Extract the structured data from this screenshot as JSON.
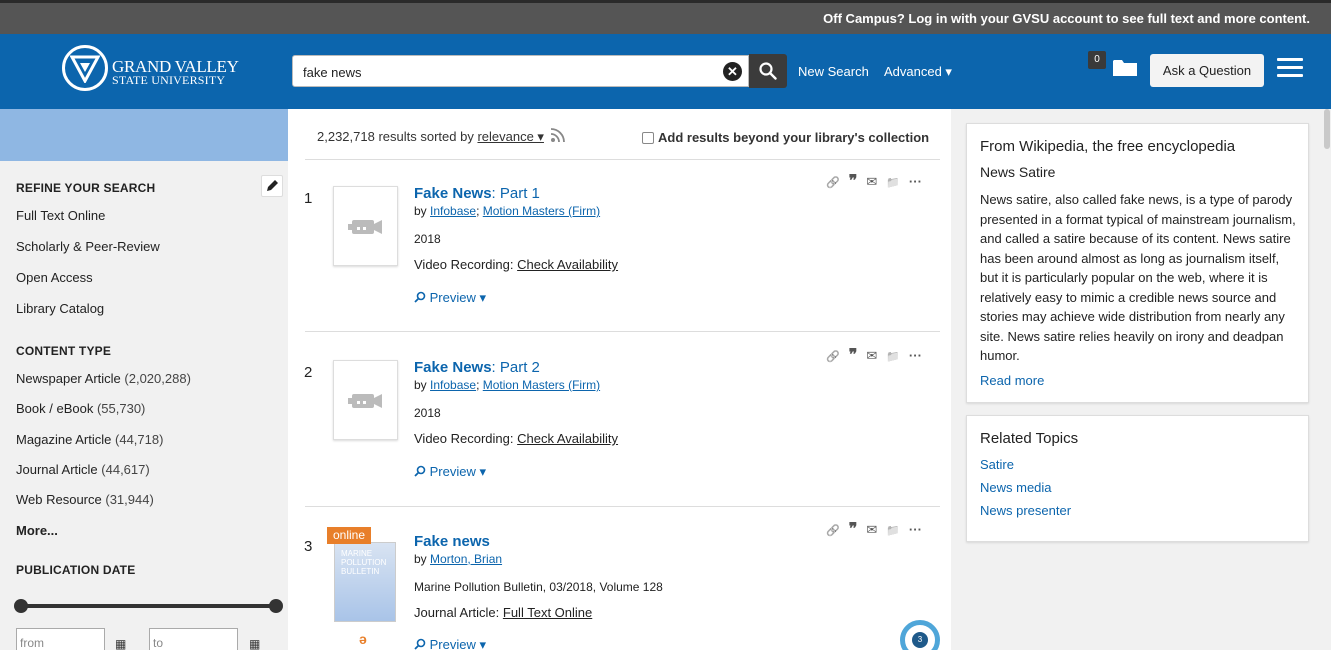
{
  "topbar": {
    "message": "Off Campus? Log in with your GVSU account to see full text and more content."
  },
  "logo": {
    "line1": "GRAND VALLEY",
    "line2": "STATE UNIVERSITY"
  },
  "search": {
    "value": "fake news",
    "clear_glyph": "✕"
  },
  "nav": {
    "new_search": "New Search",
    "advanced": "Advanced ▾"
  },
  "folder": {
    "count": "0"
  },
  "ask_button": "Ask a Question",
  "sidebar": {
    "refine_heading": "REFINE YOUR SEARCH",
    "refine_items": [
      "Full Text Online",
      "Scholarly & Peer-Review",
      "Open Access",
      "Library Catalog"
    ],
    "content_type_heading": "CONTENT TYPE",
    "content_types": [
      {
        "label": "Newspaper Article",
        "count": "(2,020,288)"
      },
      {
        "label": "Book / eBook",
        "count": "(55,730)"
      },
      {
        "label": "Magazine Article",
        "count": "(44,718)"
      },
      {
        "label": "Journal Article",
        "count": "(44,617)"
      },
      {
        "label": "Web Resource",
        "count": "(31,944)"
      }
    ],
    "more": "More...",
    "pub_date_heading": "PUBLICATION DATE",
    "from_placeholder": "from",
    "to_placeholder": "to"
  },
  "results_header": {
    "count_text": "2,232,718 results sorted by",
    "sort": "relevance ▾",
    "beyond": "Add results beyond your library's collection"
  },
  "results": [
    {
      "num": "1",
      "title_bold": "Fake News",
      "title_rest": ": Part 1",
      "by": "by",
      "author1": "Infobase",
      "author2": "Motion Masters (Firm)",
      "year": "2018",
      "type_label": "Video Recording:",
      "type_link": "Check Availability",
      "preview": "Preview ▾"
    },
    {
      "num": "2",
      "title_bold": "Fake News",
      "title_rest": ": Part 2",
      "by": "by",
      "author1": "Infobase",
      "author2": "Motion Masters (Firm)",
      "year": "2018",
      "type_label": "Video Recording:",
      "type_link": "Check Availability",
      "preview": "Preview ▾"
    },
    {
      "num": "3",
      "title_bold": "Fake news",
      "by": "by",
      "author1": "Morton, Brian",
      "source": "Marine Pollution Bulletin, 03/2018, Volume 128",
      "type_label": "Journal Article:",
      "type_link": "Full Text Online",
      "preview": "Preview ▾",
      "badge": "online",
      "thumb_text": "MARINE POLLUTION BULLETIN",
      "altmetric": "3"
    }
  ],
  "actions": {
    "link": "🔗",
    "cite": "❞",
    "email": "✉",
    "folder": "📁",
    "more": "···"
  },
  "wiki": {
    "heading": "From Wikipedia, the free encyclopedia",
    "subheading": "News Satire",
    "text": "News satire, also called fake news, is a type of parody presented in a format typical of mainstream journalism, and called a satire because of its content. News satire has been around almost as long as journalism itself, but it is particularly popular on the web, where it is relatively easy to mimic a credible news source and stories may achieve wide distribution from nearly any site. News satire relies heavily on irony and deadpan humor.",
    "read_more": "Read more"
  },
  "topics": {
    "heading": "Related Topics",
    "items": [
      "Satire",
      "News media",
      "News presenter"
    ]
  }
}
